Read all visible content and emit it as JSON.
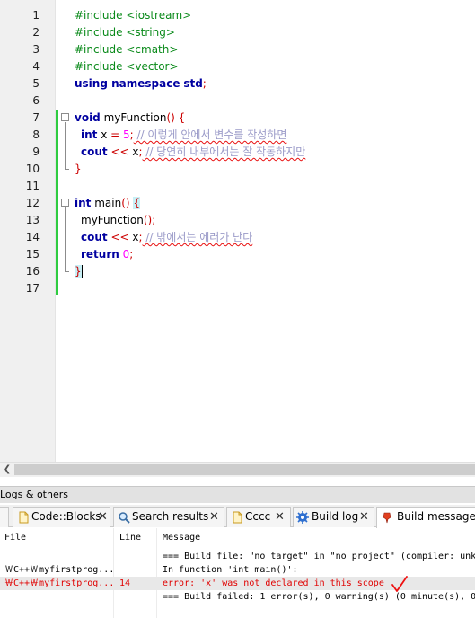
{
  "editor": {
    "line_numbers": [
      "1",
      "2",
      "3",
      "4",
      "5",
      "6",
      "7",
      "8",
      "9",
      "10",
      "11",
      "12",
      "13",
      "14",
      "15",
      "16",
      "17"
    ],
    "lines": {
      "l1": "#include <iostream>",
      "l2": "#include <string>",
      "l3": "#include <cmath>",
      "l4": "#include <vector>",
      "l5_kw": "using namespace",
      "l5_ns": "std",
      "l5_semi": ";",
      "l7_kw": "void",
      "l7_name": " myFunction",
      "l7_paren": "()",
      "l7_brace": " {",
      "l8_kw": "int",
      "l8_var": " x ",
      "l8_eq": "=",
      "l8_num": " 5",
      "l8_semi": ";",
      "l8_cm": " // 이렇게 안에서 변수를 작성하면",
      "l9_kw": "cout",
      "l9_op": " <<",
      "l9_var": " x",
      "l9_semi": ";",
      "l9_cm": " // 당연히 내부에서는 잘 작동하지만",
      "l10_brace": "}",
      "l12_kw": "int",
      "l12_name": " main",
      "l12_paren": "()",
      "l12_brace": "{",
      "l13_call": "myFunction",
      "l13_paren": "()",
      "l13_semi": ";",
      "l14_kw": "cout",
      "l14_op": " <<",
      "l14_var": " x",
      "l14_semi": ";",
      "l14_cm": " // 밖에서는 에러가 난다",
      "l15_kw": "return",
      "l15_num": " 0",
      "l15_semi": ";",
      "l16_brace": "}"
    }
  },
  "logs": {
    "title": "Logs & others",
    "tabs": [
      {
        "label": "Code::Blocks",
        "icon": "document-icon"
      },
      {
        "label": "Search results",
        "icon": "search-icon"
      },
      {
        "label": "Cccc",
        "icon": "document-icon"
      },
      {
        "label": "Build log",
        "icon": "gear-icon"
      },
      {
        "label": "Build messages",
        "icon": "pin-icon"
      }
    ],
    "columns": {
      "file": "File",
      "line": "Line",
      "message": "Message"
    },
    "rows": [
      {
        "file": "",
        "line": "",
        "message": "=== Build file: \"no target\" in \"no project\" (compiler: unk"
      },
      {
        "file": "￦C++￦myfirstprog...",
        "line": "",
        "message": "In function 'int main()':"
      },
      {
        "file": "￦C++￦myfirstprog...",
        "line": "14",
        "message": "error: 'x' was not declared in this scope"
      },
      {
        "file": "",
        "line": "",
        "message": "=== Build failed: 1 error(s), 0 warning(s) (0 minute(s), 0"
      }
    ]
  },
  "colors": {
    "preprocessor": "#0a8a1a",
    "keyword": "#0000a0",
    "number": "#ff00ff",
    "operator": "#cc0000",
    "comment": "#9a9ac8",
    "error_text": "#e00000",
    "change_bar": "#2ecc40"
  }
}
